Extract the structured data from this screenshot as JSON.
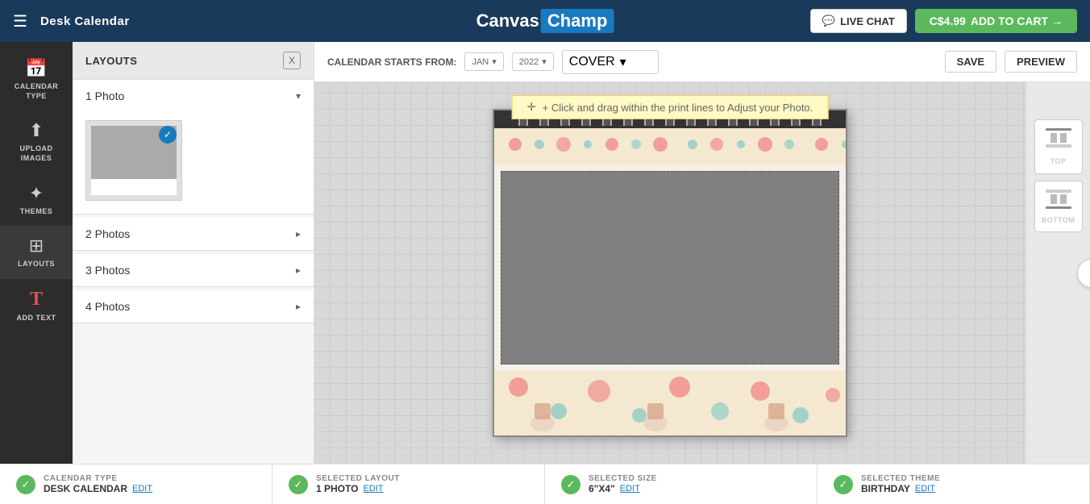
{
  "navbar": {
    "hamburger": "☰",
    "title": "Desk Calendar",
    "logo_canvas": "Canvas",
    "logo_champ": "Champ",
    "live_chat_label": "LIVE CHAT",
    "price": "C$4.99",
    "add_to_cart_label": "ADD TO CART →"
  },
  "sidebar": {
    "items": [
      {
        "id": "calendar-type",
        "label": "CALENDAR\nTYPE",
        "icon": "📅"
      },
      {
        "id": "upload-images",
        "label": "UPLOAD\nIMAGES",
        "icon": "⬆"
      },
      {
        "id": "themes",
        "label": "THEMES",
        "icon": "☀"
      },
      {
        "id": "layouts",
        "label": "LAYOUTS",
        "icon": "⊞"
      },
      {
        "id": "add-text",
        "label": "ADD TEXT",
        "icon": "T"
      }
    ]
  },
  "layouts_panel": {
    "title": "LAYOUTS",
    "close_label": "X",
    "groups": [
      {
        "label": "1 Photo",
        "expanded": true,
        "arrow": "▾"
      },
      {
        "label": "2 Photos",
        "expanded": false,
        "arrow": "▸"
      },
      {
        "label": "3 Photos",
        "expanded": false,
        "arrow": "▸"
      },
      {
        "label": "4 Photos",
        "expanded": false,
        "arrow": "▸"
      }
    ]
  },
  "toolbar": {
    "calendar_starts_from_label": "CALENDAR STARTS FROM:",
    "month": "JAN",
    "year": "2022",
    "cover": "COVER",
    "save_label": "SAVE",
    "preview_label": "PREVIEW"
  },
  "canvas": {
    "drag_hint": "+ Click and drag within the print lines to Adjust your Photo."
  },
  "right_panel": {
    "top_label": "Top",
    "bottom_label": "Bottom",
    "next_arrow": "›"
  },
  "status_bar": {
    "items": [
      {
        "title": "CALENDAR TYPE",
        "value": "DESK CALENDAR",
        "edit": "EDIT"
      },
      {
        "title": "SELECTED LAYOUT",
        "value": "1 PHOTO",
        "edit": "EDIT"
      },
      {
        "title": "SELECTED SIZE",
        "value": "6\"X4\"",
        "edit": "EDIT"
      },
      {
        "title": "SELECTED THEME",
        "value": "BIRTHDAY",
        "edit": "EDIT"
      }
    ]
  }
}
